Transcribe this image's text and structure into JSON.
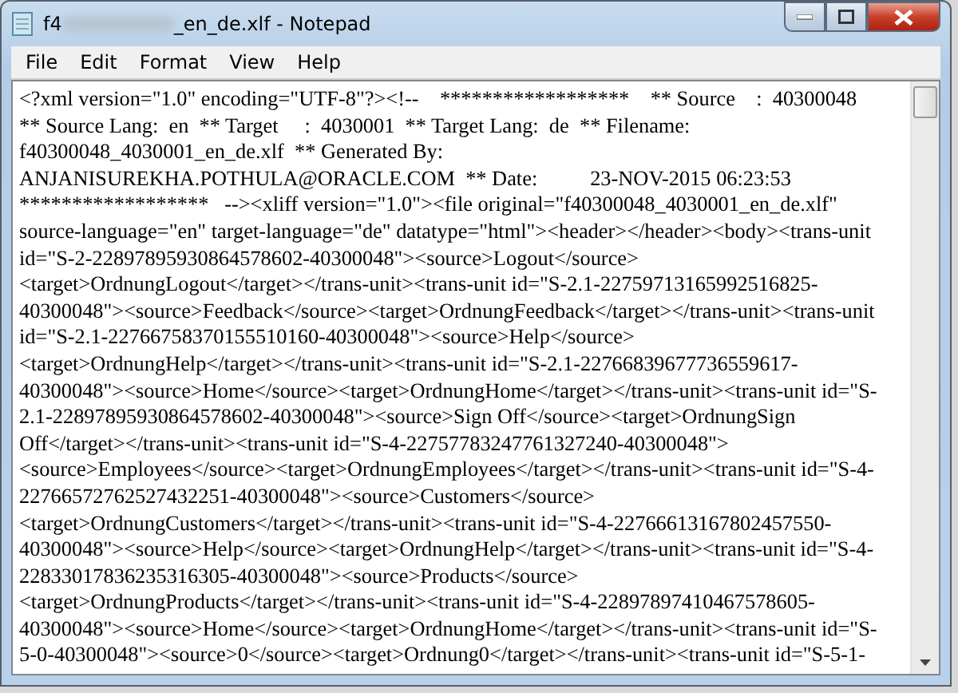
{
  "window": {
    "title_start": "f4",
    "title_end": "_en_de.xlf - Notepad"
  },
  "menu": [
    "File",
    "Edit",
    "Format",
    "View",
    "Help"
  ],
  "editor": {
    "lines": [
      "<?xml version=\"1.0\" encoding=\"UTF-8\"?><!--    ******************    ** Source    :  40300048",
      "** Source Lang:  en  ** Target     :  4030001  ** Target Lang:  de  ** Filename:",
      "f40300048_4030001_en_de.xlf  ** Generated By:",
      "ANJANISUREKHA.POTHULA@ORACLE.COM  ** Date:          23-NOV-2015 06:23:53",
      "******************   --><xliff version=\"1.0\"><file original=\"f40300048_4030001_en_de.xlf\"",
      "source-language=\"en\" target-language=\"de\" datatype=\"html\"><header></header><body><trans-unit",
      "id=\"S-2-22897895930864578602-40300048\"><source>Logout</source>",
      "<target>OrdnungLogout</target></trans-unit><trans-unit id=\"S-2.1-22759713165992516825-",
      "40300048\"><source>Feedback</source><target>OrdnungFeedback</target></trans-unit><trans-unit",
      "id=\"S-2.1-22766758370155510160-40300048\"><source>Help</source>",
      "<target>OrdnungHelp</target></trans-unit><trans-unit id=\"S-2.1-22766839677736559617-",
      "40300048\"><source>Home</source><target>OrdnungHome</target></trans-unit><trans-unit id=\"S-",
      "2.1-22897895930864578602-40300048\"><source>Sign Off</source><target>OrdnungSign",
      "Off</target></trans-unit><trans-unit id=\"S-4-22757783247761327240-40300048\">",
      "<source>Employees</source><target>OrdnungEmployees</target></trans-unit><trans-unit id=\"S-4-",
      "22766572762527432251-40300048\"><source>Customers</source>",
      "<target>OrdnungCustomers</target></trans-unit><trans-unit id=\"S-4-22766613167802457550-",
      "40300048\"><source>Help</source><target>OrdnungHelp</target></trans-unit><trans-unit id=\"S-4-",
      "22833017836235316305-40300048\"><source>Products</source>",
      "<target>OrdnungProducts</target></trans-unit><trans-unit id=\"S-4-22897897410467578605-",
      "40300048\"><source>Home</source><target>OrdnungHome</target></trans-unit><trans-unit id=\"S-",
      "5-0-40300048\"><source>0</source><target>Ordnung0</target></trans-unit><trans-unit id=\"S-5-1-"
    ]
  }
}
